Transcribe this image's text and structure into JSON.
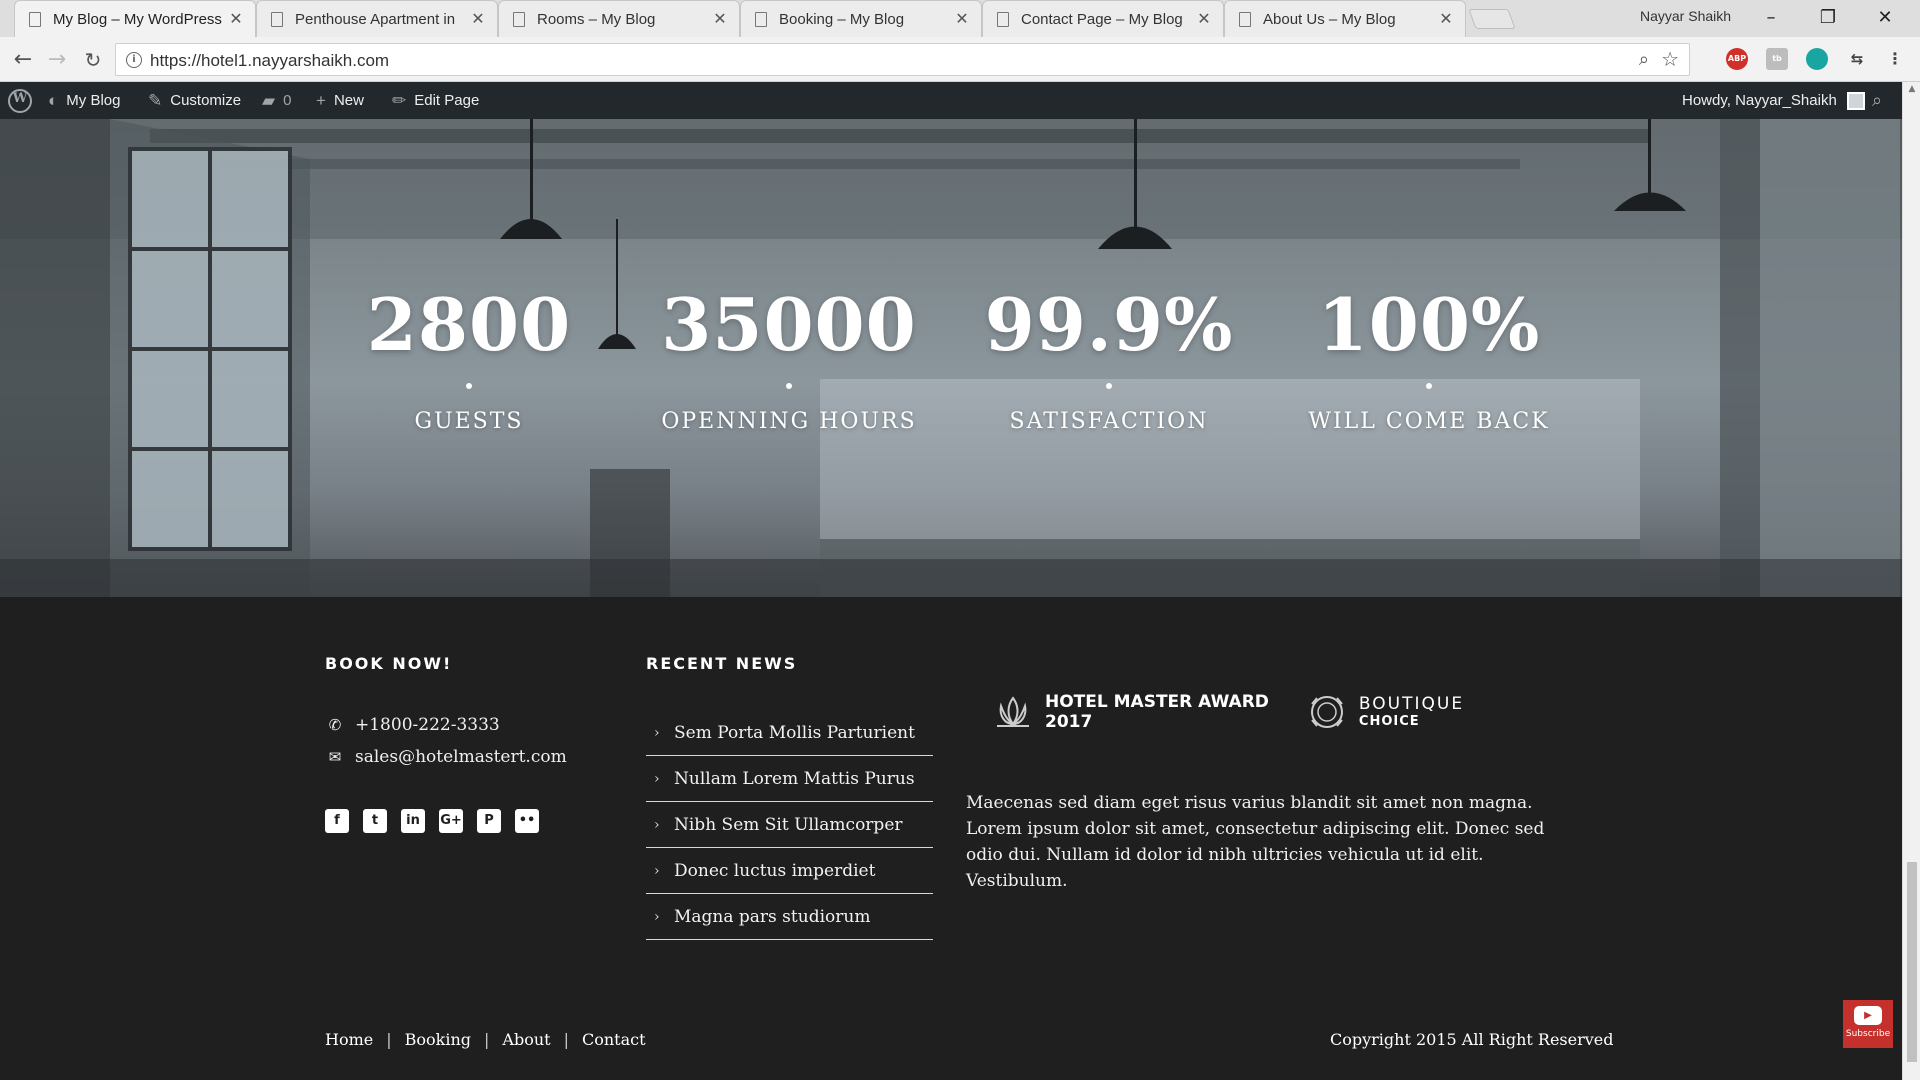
{
  "browser": {
    "tabs": [
      {
        "title": "My Blog – My WordPress",
        "active": true
      },
      {
        "title": "Penthouse Apartment in",
        "active": false
      },
      {
        "title": "Rooms – My Blog",
        "active": false
      },
      {
        "title": "Booking – My Blog",
        "active": false
      },
      {
        "title": "Contact Page – My Blog",
        "active": false
      },
      {
        "title": "About Us – My Blog",
        "active": false
      }
    ],
    "profile_name": "Nayyar Shaikh",
    "url": "https://hotel1.nayyarshaikh.com",
    "extensions": [
      "ABP",
      "tb",
      "",
      ""
    ]
  },
  "adminbar": {
    "site": "My Blog",
    "customize": "Customize",
    "comments_count": "0",
    "new": "New",
    "edit_page": "Edit Page",
    "howdy": "Howdy, Nayyar_Shaikh"
  },
  "stats": [
    {
      "number": "2800",
      "label": "GUESTS"
    },
    {
      "number": "35000",
      "label": "OPENNING HOURS"
    },
    {
      "number": "99.9%",
      "label": "SATISFACTION"
    },
    {
      "number": "100%",
      "label": "WILL COME BACK"
    }
  ],
  "footer": {
    "book": {
      "heading": "BOOK NOW!",
      "phone": "+1800-222-3333",
      "email": "sales@hotelmastert.com",
      "socials": [
        "facebook-icon",
        "twitter-icon",
        "linkedin-icon",
        "google-plus-icon",
        "pinterest-icon",
        "flickr-icon"
      ]
    },
    "news": {
      "heading": "RECENT NEWS",
      "items": [
        "Sem Porta Mollis Parturient",
        "Nullam Lorem Mattis Purus",
        "Nibh Sem Sit Ullamcorper",
        "Donec luctus imperdiet",
        "Magna pars studiorum"
      ]
    },
    "awards": {
      "award1_line1": "HOTEL MASTER AWARD",
      "award1_line2": "2017",
      "award2_line1": "BOUTIQUE",
      "award2_line2": "CHOICE"
    },
    "about_text": "Maecenas sed diam eget risus varius blandit sit amet non magna. Lorem ipsum dolor sit amet, consectetur adipiscing elit. Donec sed odio dui. Nullam id dolor id nibh ultricies vehicula ut id elit. Vestibulum.",
    "links": [
      "Home",
      "Booking",
      "About",
      "Contact"
    ],
    "copyright": "Copyright 2015 All Right Reserved"
  },
  "subscribe_label": "Subscribe"
}
